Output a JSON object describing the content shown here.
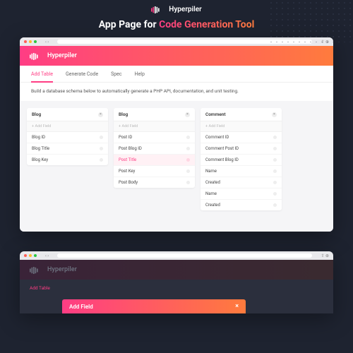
{
  "brand": {
    "name": "Hyperpiler"
  },
  "hero": {
    "prefix": "App Page for ",
    "highlight": "Code Generation Tool"
  },
  "tabs": {
    "add_table": "Add Table",
    "generate_code": "Generate Code",
    "spec": "Spec",
    "help": "Help"
  },
  "intro": "Build a database schema below to automatically generate a PHP API, documentation, and unit testing.",
  "add_field": "+ Add Field",
  "cards": [
    {
      "title": "Blog",
      "fields": [
        "Blog ID",
        "Blog Title",
        "Blog Key"
      ]
    },
    {
      "title": "Blog",
      "fields": [
        "Post ID",
        "Post Blog ID",
        "Post Title",
        "Post Key",
        "Post Body"
      ],
      "highlight": 2
    },
    {
      "title": "Comment",
      "fields": [
        "Comment ID",
        "Comment Post ID",
        "Comment Blog ID",
        "Name",
        "Created",
        "Name",
        "Created"
      ]
    }
  ],
  "modal": {
    "title": "Add Field",
    "close": "×"
  }
}
